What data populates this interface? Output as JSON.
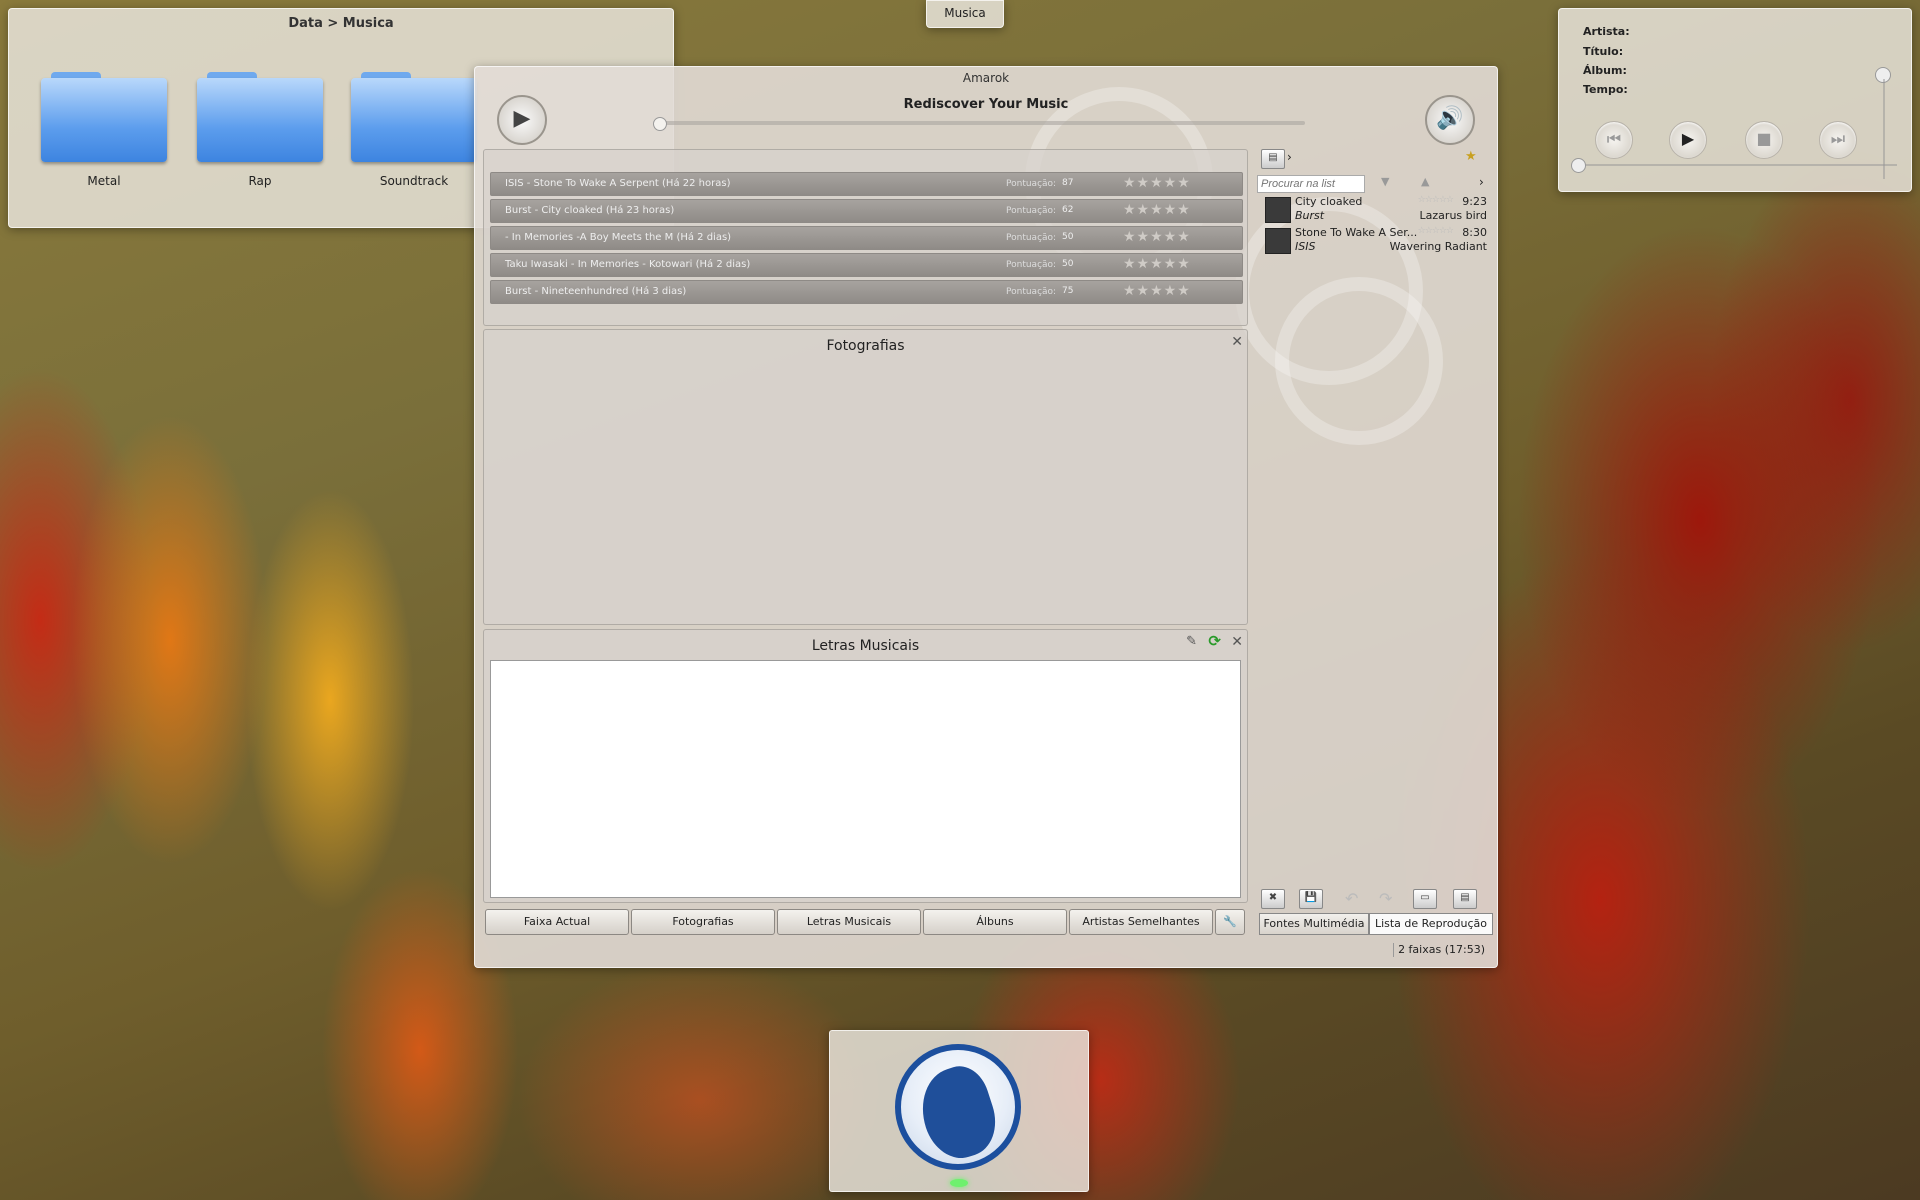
{
  "folder_window": {
    "title": "Data > Musica",
    "folders": [
      {
        "label": "Metal"
      },
      {
        "label": "Rap"
      },
      {
        "label": "Soundtrack"
      }
    ]
  },
  "taskbar": {
    "label": "Musica"
  },
  "now_playing_widget": {
    "artista_label": "Artista:",
    "titulo_label": "Título:",
    "album_label": "Álbum:",
    "tempo_label": "Tempo:"
  },
  "amarok": {
    "window_title": "Amarok",
    "headline": "Rediscover Your Music",
    "recent_tracks": [
      {
        "text": "ISIS - Stone To Wake A Serpent (Há 22 horas)",
        "score_label": "Pontuação:",
        "score": "87"
      },
      {
        "text": "Burst - City cloaked (Há 23 horas)",
        "score_label": "Pontuação:",
        "score": "62"
      },
      {
        "text": " - In Memories -A Boy Meets the M (Há 2 dias)",
        "score_label": "Pontuação:",
        "score": "50"
      },
      {
        "text": "Taku Iwasaki - In Memories - Kotowari (Há 2 dias)",
        "score_label": "Pontuação:",
        "score": "50"
      },
      {
        "text": "Burst - Nineteenhundred (Há 3 dias)",
        "score_label": "Pontuação:",
        "score": "75"
      }
    ],
    "photos_title": "Fotografias",
    "lyrics_title": "Letras Musicais",
    "tabs": [
      "Faixa Actual",
      "Fotografias",
      "Letras Musicais",
      "Álbuns",
      "Artistas Semelhantes"
    ],
    "playlist": {
      "search_placeholder": "Procurar na list",
      "tracks": [
        {
          "title": "City cloaked",
          "duration": "9:23",
          "artist": "Burst",
          "album": "Lazarus bird"
        },
        {
          "title": "Stone To Wake A Ser...",
          "duration": "8:30",
          "artist": "ISIS",
          "album": "Wavering Radiant"
        }
      ],
      "bottom_tabs": [
        "Fontes Multimédia",
        "Lista de Reprodução"
      ],
      "status": "2 faixas (17:53)"
    }
  }
}
